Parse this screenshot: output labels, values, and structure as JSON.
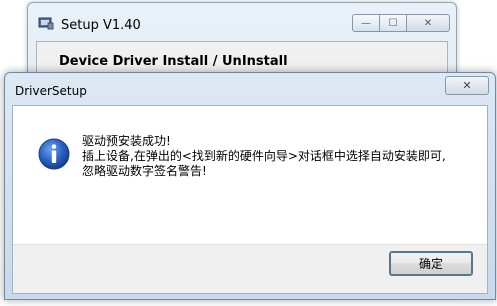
{
  "setup_window": {
    "title": "Setup V1.40",
    "group_title": "Device Driver Install / UnInstall",
    "caption_buttons": {
      "minimize": "—",
      "maximize": "☐",
      "close": "✕"
    }
  },
  "dialog": {
    "title": "DriverSetup",
    "close_glyph": "✕",
    "icon": "info-icon",
    "message_lines": [
      "驱动预安装成功!",
      "插上设备,在弹出的<找到新的硬件向导>对话框中选择自动安装即可,",
      "忽略驱动数字签名警告!"
    ],
    "ok_label": "确定"
  },
  "colors": {
    "info_icon_fill": "#2a62c4",
    "button_focus": "#3c7fb1"
  }
}
